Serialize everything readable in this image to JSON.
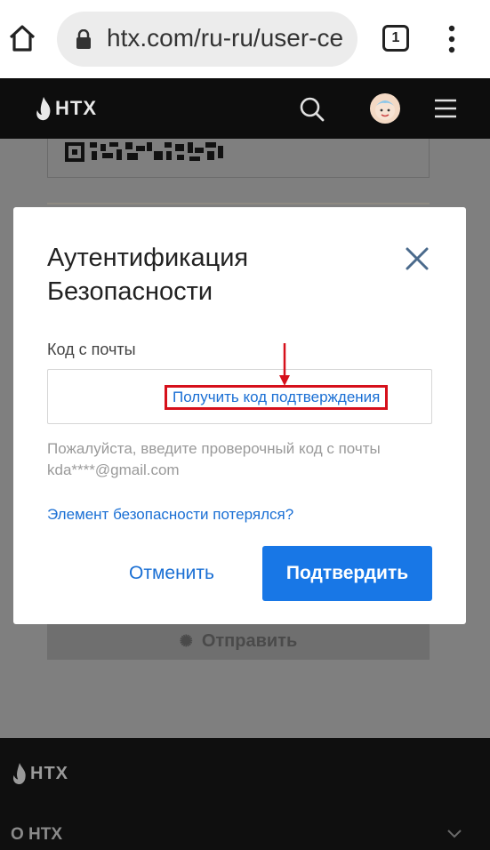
{
  "browser": {
    "url": "htx.com/ru-ru/user-ce",
    "tab_count": "1"
  },
  "header": {
    "logo": "HTX"
  },
  "background": {
    "send_button": "Отправить"
  },
  "modal": {
    "title_line1": "Аутентификация",
    "title_line2": "Безопасности",
    "field_label": "Код с почты",
    "get_code_link": "Получить код подтверждения",
    "hint_text": "Пожалуйста, введите проверочный код с почты",
    "hint_email": "kda****@gmail.com",
    "lost_link": "Элемент безопасности потерялся?",
    "cancel_label": "Отменить",
    "confirm_label": "Подтвердить"
  },
  "footer": {
    "logo": "HTX",
    "about_label": "О HTX"
  },
  "colors": {
    "accent": "#1877e6",
    "link": "#1a6fd4",
    "highlight": "#d6101b",
    "header_bg": "#0d0d0d"
  }
}
